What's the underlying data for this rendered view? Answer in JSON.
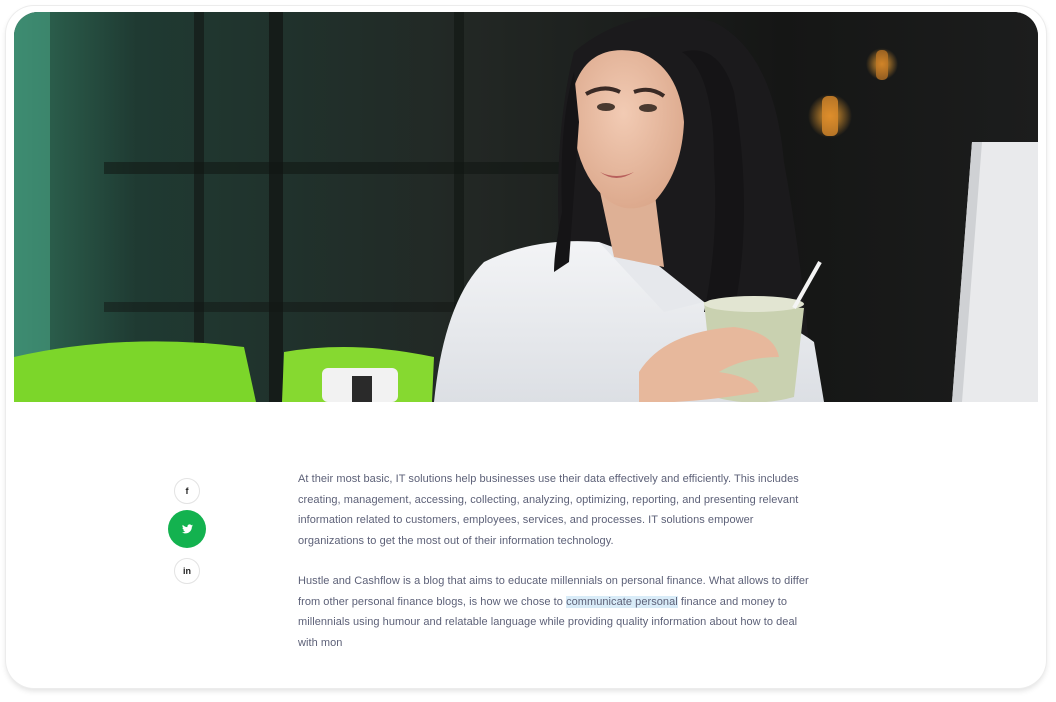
{
  "hero": {
    "image_name": "hero-photo-woman-with-coffee"
  },
  "share": {
    "facebook_label": "f",
    "linkedin_label": "in"
  },
  "article": {
    "para1": "At their most basic, IT solutions help businesses use their data  effectively and efficiently. This includes creating, management,  accessing, collecting, analyzing, optimizing, reporting, and presenting  relevant information related to customers, employees, services, and  processes. IT solutions empower organizations to get the most out of  their information technology.",
    "para2_before": "Hustle and Cashflow is a blog that aims to educate millennials on  personal finance. What allows to differ from other personal finance  blogs, is how we chose to ",
    "para2_highlight": "communicate personal",
    "para2_after": " finance and money to  millennials using humour and relatable language while providing quality  information about how to deal with mon"
  },
  "colors": {
    "accent": "#13b24f",
    "text": "#5d6178",
    "highlight": "#d9ecf8"
  }
}
